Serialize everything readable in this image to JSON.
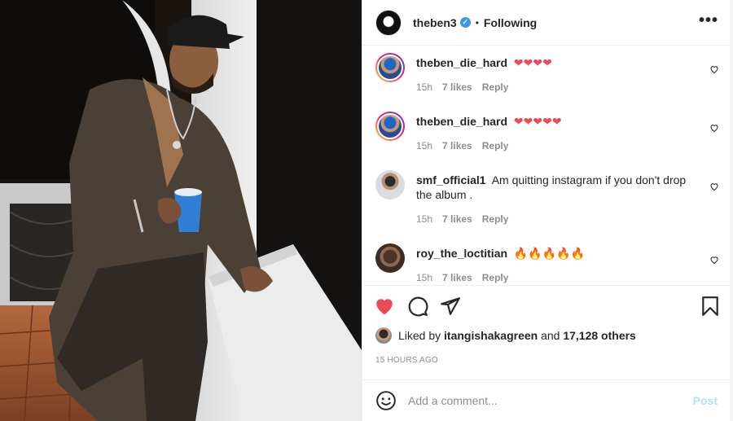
{
  "post": {
    "author": "theben3",
    "verified_mark": "✓",
    "separator": "•",
    "follow_state": "Following",
    "more_glyph": "•••"
  },
  "comments": [
    {
      "user": "theben_die_hard",
      "text": "❤❤❤❤",
      "age": "15h",
      "likes": "7 likes",
      "reply": "Reply",
      "avatar": "story-ring"
    },
    {
      "user": "theben_die_hard",
      "text": "❤❤❤❤❤",
      "age": "15h",
      "likes": "7 likes",
      "reply": "Reply",
      "avatar": "story-ring"
    },
    {
      "user": "smf_official1",
      "text": "Am quitting instagram if you don't drop the album .",
      "age": "15h",
      "likes": "7 likes",
      "reply": "Reply",
      "avatar": "plain"
    },
    {
      "user": "roy_the_loctitian",
      "text": "🔥🔥🔥🔥🔥",
      "age": "15h",
      "likes": "7 likes",
      "reply": "Reply",
      "avatar": "plain"
    }
  ],
  "likes": {
    "prefix": "Liked by",
    "user": "itangishakagreen",
    "and": "and",
    "others": "17,128 others"
  },
  "timestamp": "15 HOURS AGO",
  "add_comment": {
    "placeholder": "Add a comment...",
    "post_label": "Post"
  },
  "colors": {
    "like_red": "#ed4956",
    "link_blue": "#3897f0",
    "post_disabled": "#b2dffc",
    "meta_gray": "#8e8e8e"
  },
  "icons": [
    "heart-filled-icon",
    "comment-icon",
    "share-icon",
    "bookmark-icon",
    "emoji-icon",
    "small-heart-icon",
    "more-options-icon",
    "verified-badge-icon"
  ]
}
